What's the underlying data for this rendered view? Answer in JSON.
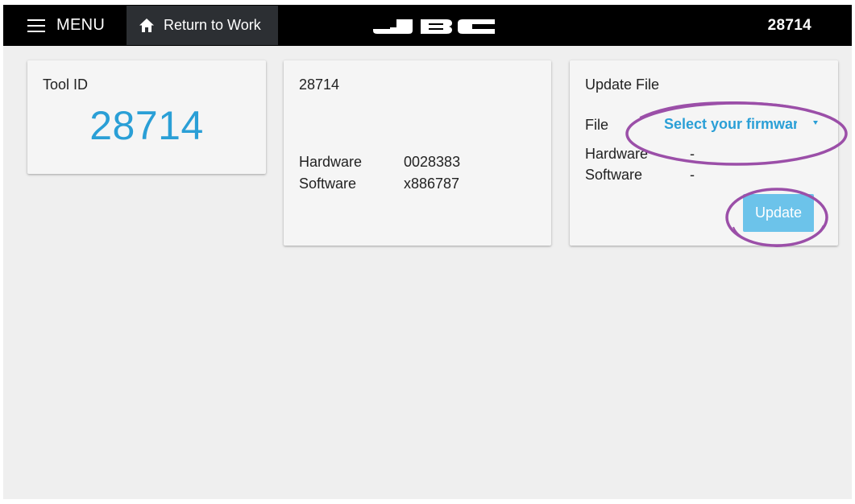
{
  "header": {
    "menu_label": "MENU",
    "return_label": "Return to Work",
    "logo_text": "JBC",
    "tool_id": "28714"
  },
  "tool_id_card": {
    "title": "Tool ID",
    "value": "28714"
  },
  "info_card": {
    "title": "28714",
    "hardware_label": "Hardware",
    "hardware_value": "0028383",
    "software_label": "Software",
    "software_value": "x886787"
  },
  "update_card": {
    "title": "Update File",
    "file_label": "File",
    "file_select_text": "Select your firmware",
    "hardware_label": "Hardware",
    "hardware_value": "-",
    "software_label": "Software",
    "software_value": "-",
    "update_label": "Update"
  },
  "icons": [
    "hamburger-menu-icon",
    "home-icon",
    "chevron-down-icon"
  ],
  "colors": {
    "accent": "#2a9fd6",
    "button": "#6cc3ea",
    "header": "#000000",
    "annotation": "#9b4fa8"
  }
}
